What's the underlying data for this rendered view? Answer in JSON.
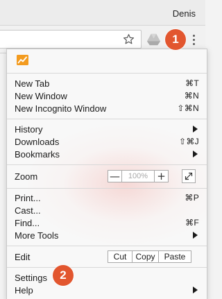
{
  "window": {
    "profile_name": "Denis"
  },
  "toolbar": {
    "star_icon": "star-icon",
    "extension_icon": "drive-extension-icon",
    "menu_icon": "more-vert-icon"
  },
  "steps": {
    "first": "1",
    "second": "2",
    "color": "#e2562f"
  },
  "menu": {
    "header_icon": "analytics-chart-icon",
    "accent_color": "#f39b1f",
    "groups": [
      {
        "items": [
          {
            "label": "New Tab",
            "shortcut": "⌘T"
          },
          {
            "label": "New Window",
            "shortcut": "⌘N"
          },
          {
            "label": "New Incognito Window",
            "shortcut": "⇧⌘N"
          }
        ]
      },
      {
        "items": [
          {
            "label": "History",
            "submenu": true
          },
          {
            "label": "Downloads",
            "shortcut": "⇧⌘J"
          },
          {
            "label": "Bookmarks",
            "submenu": true
          }
        ]
      }
    ],
    "zoom": {
      "label": "Zoom",
      "minus": "—",
      "value": "100%",
      "plus": "+"
    },
    "tools": [
      {
        "label": "Print...",
        "shortcut": "⌘P"
      },
      {
        "label": "Cast..."
      },
      {
        "label": "Find...",
        "shortcut": "⌘F"
      },
      {
        "label": "More Tools",
        "submenu": true
      }
    ],
    "edit": {
      "label": "Edit",
      "cut": "Cut",
      "copy": "Copy",
      "paste": "Paste"
    },
    "bottom": [
      {
        "label": "Settings"
      },
      {
        "label": "Help",
        "submenu": true
      }
    ]
  }
}
